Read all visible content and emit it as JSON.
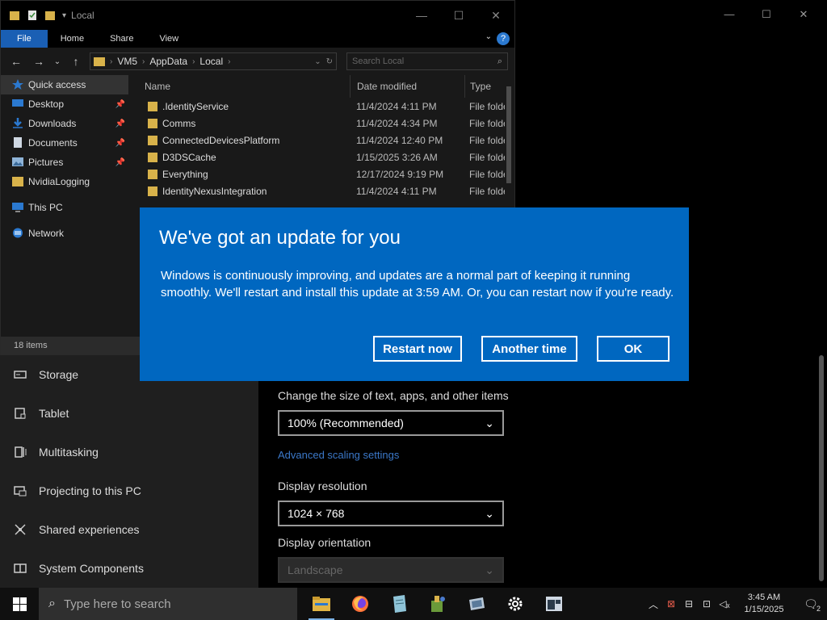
{
  "settings": {
    "window_controls": [
      "—",
      "☐",
      "✕"
    ],
    "sidebar": [
      {
        "label": "Storage",
        "icon": "storage-icon"
      },
      {
        "label": "Tablet",
        "icon": "tablet-icon"
      },
      {
        "label": "Multitasking",
        "icon": "multitasking-icon"
      },
      {
        "label": "Projecting to this PC",
        "icon": "projecting-icon"
      },
      {
        "label": "Shared experiences",
        "icon": "shared-experiences-icon"
      },
      {
        "label": "System Components",
        "icon": "system-components-icon"
      }
    ],
    "scale_label": "Change the size of text, apps, and other items",
    "scale_value": "100% (Recommended)",
    "advanced_link": "Advanced scaling settings",
    "resolution_label": "Display resolution",
    "resolution_value": "1024 × 768",
    "orientation_label": "Display orientation",
    "orientation_value": "Landscape"
  },
  "explorer": {
    "title": "Local",
    "ribbon_tabs": [
      "File",
      "Home",
      "Share",
      "View"
    ],
    "breadcrumb": [
      "VM5",
      "AppData",
      "Local"
    ],
    "search_placeholder": "Search Local",
    "nav": [
      {
        "label": "Quick access",
        "pinned": false
      },
      {
        "label": "Desktop",
        "pinned": true
      },
      {
        "label": "Downloads",
        "pinned": true
      },
      {
        "label": "Documents",
        "pinned": true
      },
      {
        "label": "Pictures",
        "pinned": true
      },
      {
        "label": "NvidiaLogging",
        "pinned": false
      },
      {
        "label": "This PC",
        "pinned": false
      },
      {
        "label": "Network",
        "pinned": false
      }
    ],
    "columns": [
      "Name",
      "Date modified",
      "Type"
    ],
    "rows": [
      {
        "name": ".IdentityService",
        "date": "11/4/2024 4:11 PM",
        "type": "File folder"
      },
      {
        "name": "Comms",
        "date": "11/4/2024 4:34 PM",
        "type": "File folder"
      },
      {
        "name": "ConnectedDevicesPlatform",
        "date": "11/4/2024 12:40 PM",
        "type": "File folder"
      },
      {
        "name": "D3DSCache",
        "date": "1/15/2025 3:26 AM",
        "type": "File folder"
      },
      {
        "name": "Everything",
        "date": "12/17/2024 9:19 PM",
        "type": "File folder"
      },
      {
        "name": "IdentityNexusIntegration",
        "date": "11/4/2024 4:11 PM",
        "type": "File folder"
      }
    ],
    "status": "18 items"
  },
  "dialog": {
    "title": "We've got an update for you",
    "body": "Windows is continuously improving, and updates are a normal part of keeping it running smoothly. We'll restart and install this update at 3:59 AM. Or, you can restart now if you're ready.",
    "buttons": {
      "restart": "Restart now",
      "another": "Another time",
      "ok": "OK"
    },
    "color": "#0067c0"
  },
  "taskbar": {
    "search_placeholder": "Type here to search",
    "apps": [
      "file-explorer-icon",
      "firefox-icon",
      "notepad-icon",
      "paint-icon",
      "remote-desktop-icon",
      "settings-icon",
      "window-app-icon"
    ],
    "time": "3:45 AM",
    "date": "1/15/2025",
    "notification_count": "2"
  }
}
